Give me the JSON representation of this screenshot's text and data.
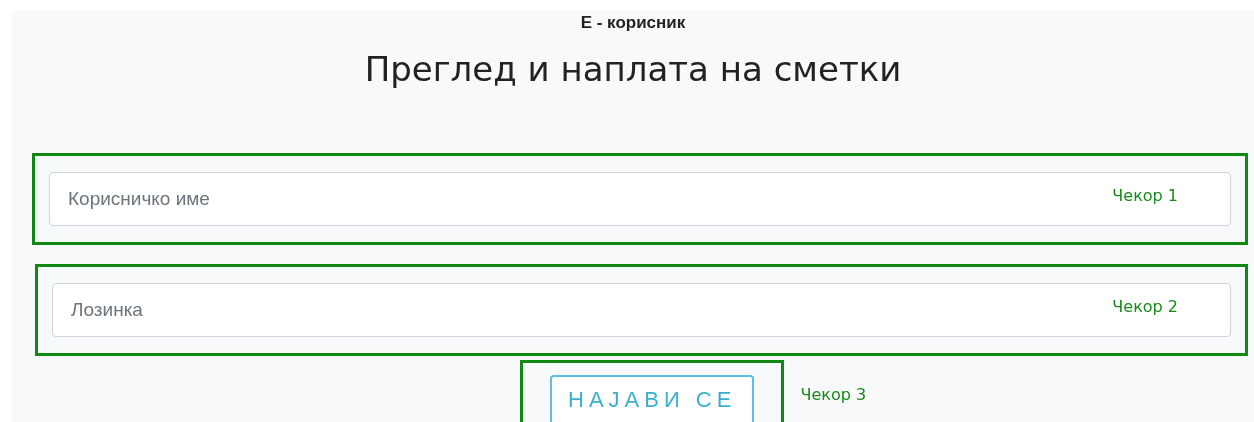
{
  "header": {
    "subtitle": "E - корисник",
    "title": "Преглед и наплата на сметки"
  },
  "fields": [
    {
      "placeholder": "Корисничко име",
      "step": "Чекор 1"
    },
    {
      "placeholder": "Лозинка",
      "step": "Чекор 2"
    }
  ],
  "login_button": {
    "label": "НАЈАВИ СЕ",
    "step": "Чекор 3"
  }
}
